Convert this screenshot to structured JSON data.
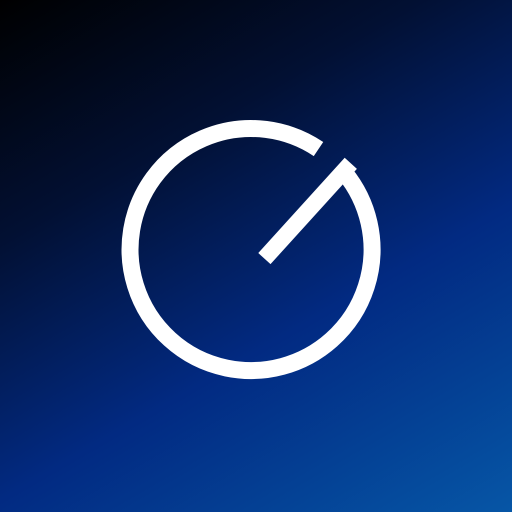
{
  "icon": {
    "logo_name": "clock-logo-icon",
    "colors": {
      "mark": "#ffffff",
      "background_top_left": "#000000",
      "background_bottom_right": "#0656a6"
    }
  }
}
